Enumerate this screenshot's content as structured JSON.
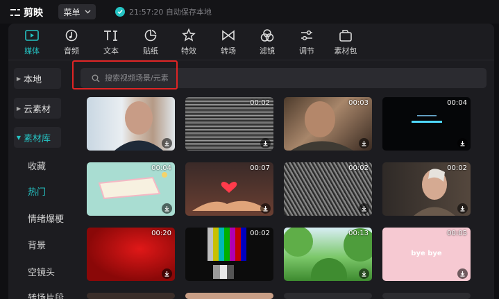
{
  "app": {
    "name": "剪映"
  },
  "menu": {
    "label": "菜单"
  },
  "save_status": {
    "text": "21:57:20 自动保存本地"
  },
  "toolbar": {
    "items": [
      {
        "label": "媒体",
        "icon": "media-icon",
        "active": true
      },
      {
        "label": "音频",
        "icon": "audio-icon"
      },
      {
        "label": "文本",
        "icon": "text-icon"
      },
      {
        "label": "贴纸",
        "icon": "sticker-icon"
      },
      {
        "label": "特效",
        "icon": "effects-icon"
      },
      {
        "label": "转场",
        "icon": "transition-icon"
      },
      {
        "label": "滤镜",
        "icon": "filter-icon"
      },
      {
        "label": "调节",
        "icon": "adjust-icon"
      },
      {
        "label": "素材包",
        "icon": "package-icon"
      }
    ]
  },
  "sidebar": {
    "items": [
      {
        "label": "本地"
      },
      {
        "label": "云素材"
      },
      {
        "label": "素材库",
        "active": true
      }
    ],
    "subitems": [
      {
        "label": "收藏"
      },
      {
        "label": "热门",
        "active": true
      },
      {
        "label": "情绪爆梗"
      },
      {
        "label": "背景"
      },
      {
        "label": "空镜头"
      },
      {
        "label": "转场片段"
      }
    ]
  },
  "search": {
    "placeholder": "搜索视频场景/元素"
  },
  "grid": {
    "items": [
      {
        "duration": "",
        "icon": "download-icon"
      },
      {
        "duration": "00:02",
        "icon": "download-icon"
      },
      {
        "duration": "00:03",
        "icon": "download-icon"
      },
      {
        "duration": "00:04",
        "icon": "download-icon"
      },
      {
        "duration": "00:04",
        "icon": "download-icon"
      },
      {
        "duration": "00:07",
        "icon": "download-icon"
      },
      {
        "duration": "00:02",
        "icon": "download-icon"
      },
      {
        "duration": "00:02",
        "icon": "download-icon"
      },
      {
        "duration": "00:20",
        "icon": "download-icon"
      },
      {
        "duration": "00:02",
        "icon": "download-icon"
      },
      {
        "duration": "00:13",
        "icon": "download-icon"
      },
      {
        "duration": "00:05",
        "icon": "download-icon"
      }
    ],
    "thumb_texts": {
      "bye": "bye bye"
    }
  },
  "colors": {
    "accent": "#25c4c4",
    "highlight": "#e02424"
  }
}
